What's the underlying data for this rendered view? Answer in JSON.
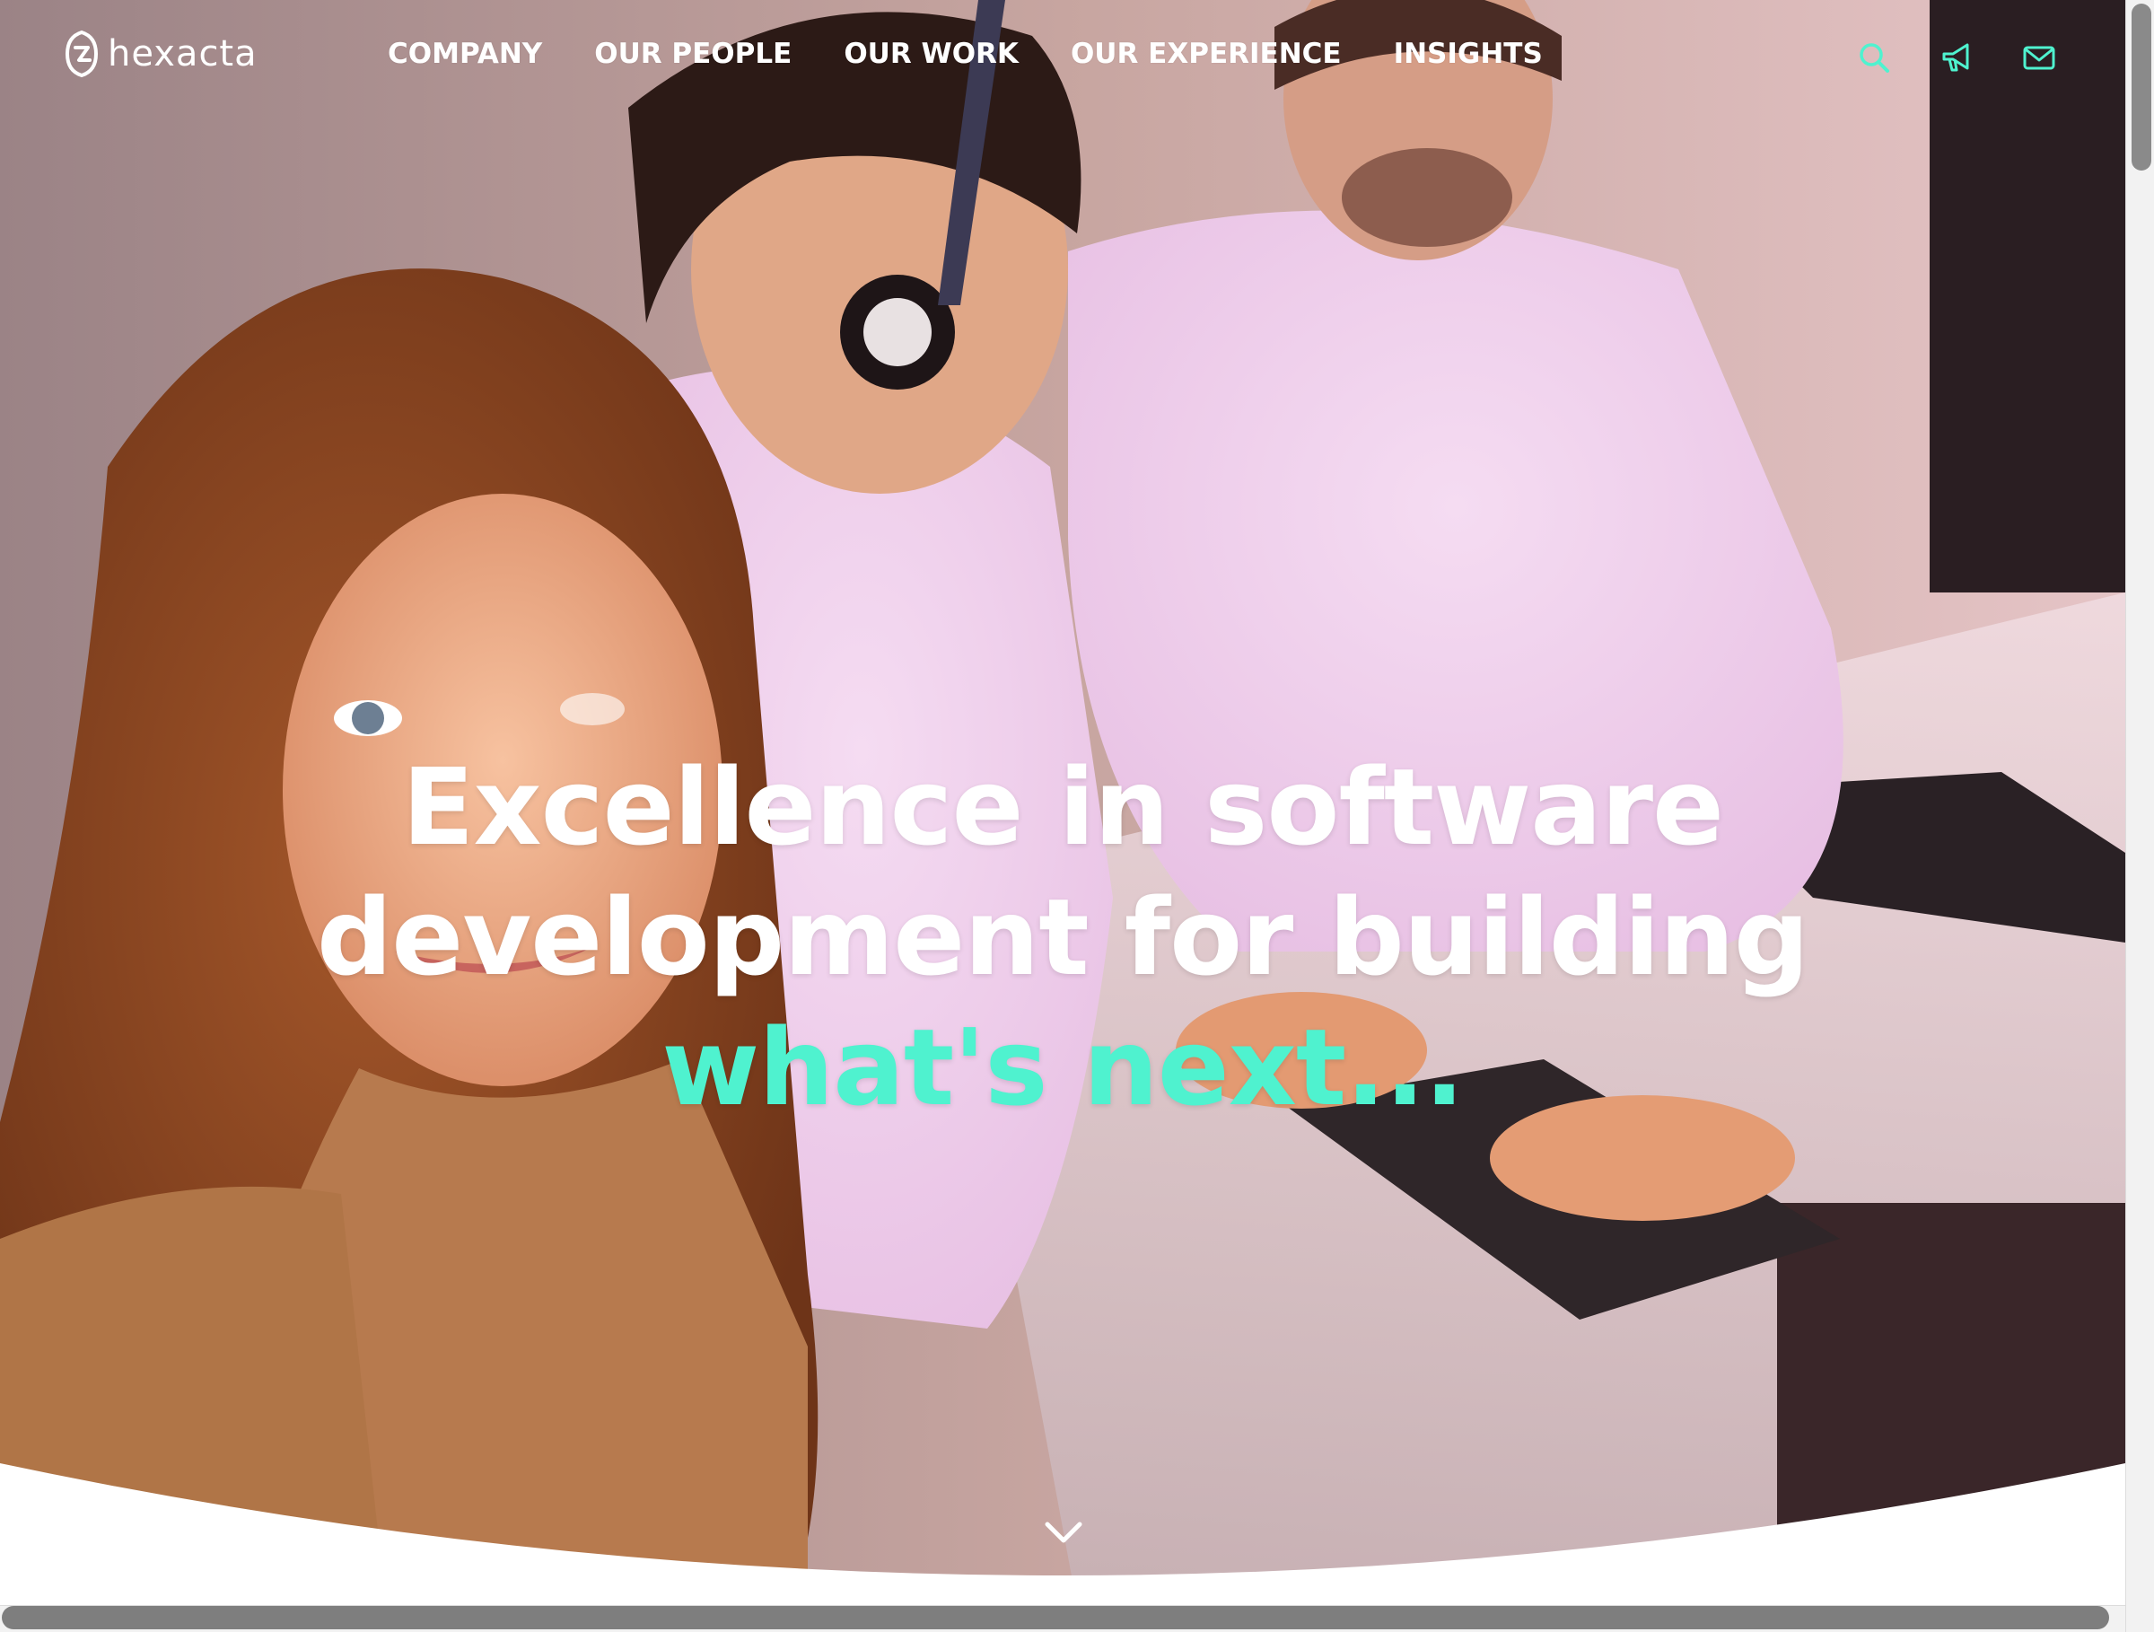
{
  "logo": {
    "text": "hexacta",
    "icon": "hexacta-logo-icon"
  },
  "nav": {
    "items": [
      {
        "label": "COMPANY"
      },
      {
        "label": "OUR PEOPLE"
      },
      {
        "label": "OUR WORK"
      },
      {
        "label": "OUR EXPERIENCE"
      },
      {
        "label": "INSIGHTS"
      }
    ],
    "icons": [
      {
        "name": "search-icon"
      },
      {
        "name": "megaphone-icon"
      },
      {
        "name": "envelope-icon"
      }
    ]
  },
  "hero": {
    "headline_line1": "Excellence in software",
    "headline_line2": "development for building",
    "headline_accent": "what's next...",
    "scroll_icon": "chevron-down-icon"
  },
  "colors": {
    "accent": "#4ff2cf",
    "text": "#ffffff"
  }
}
